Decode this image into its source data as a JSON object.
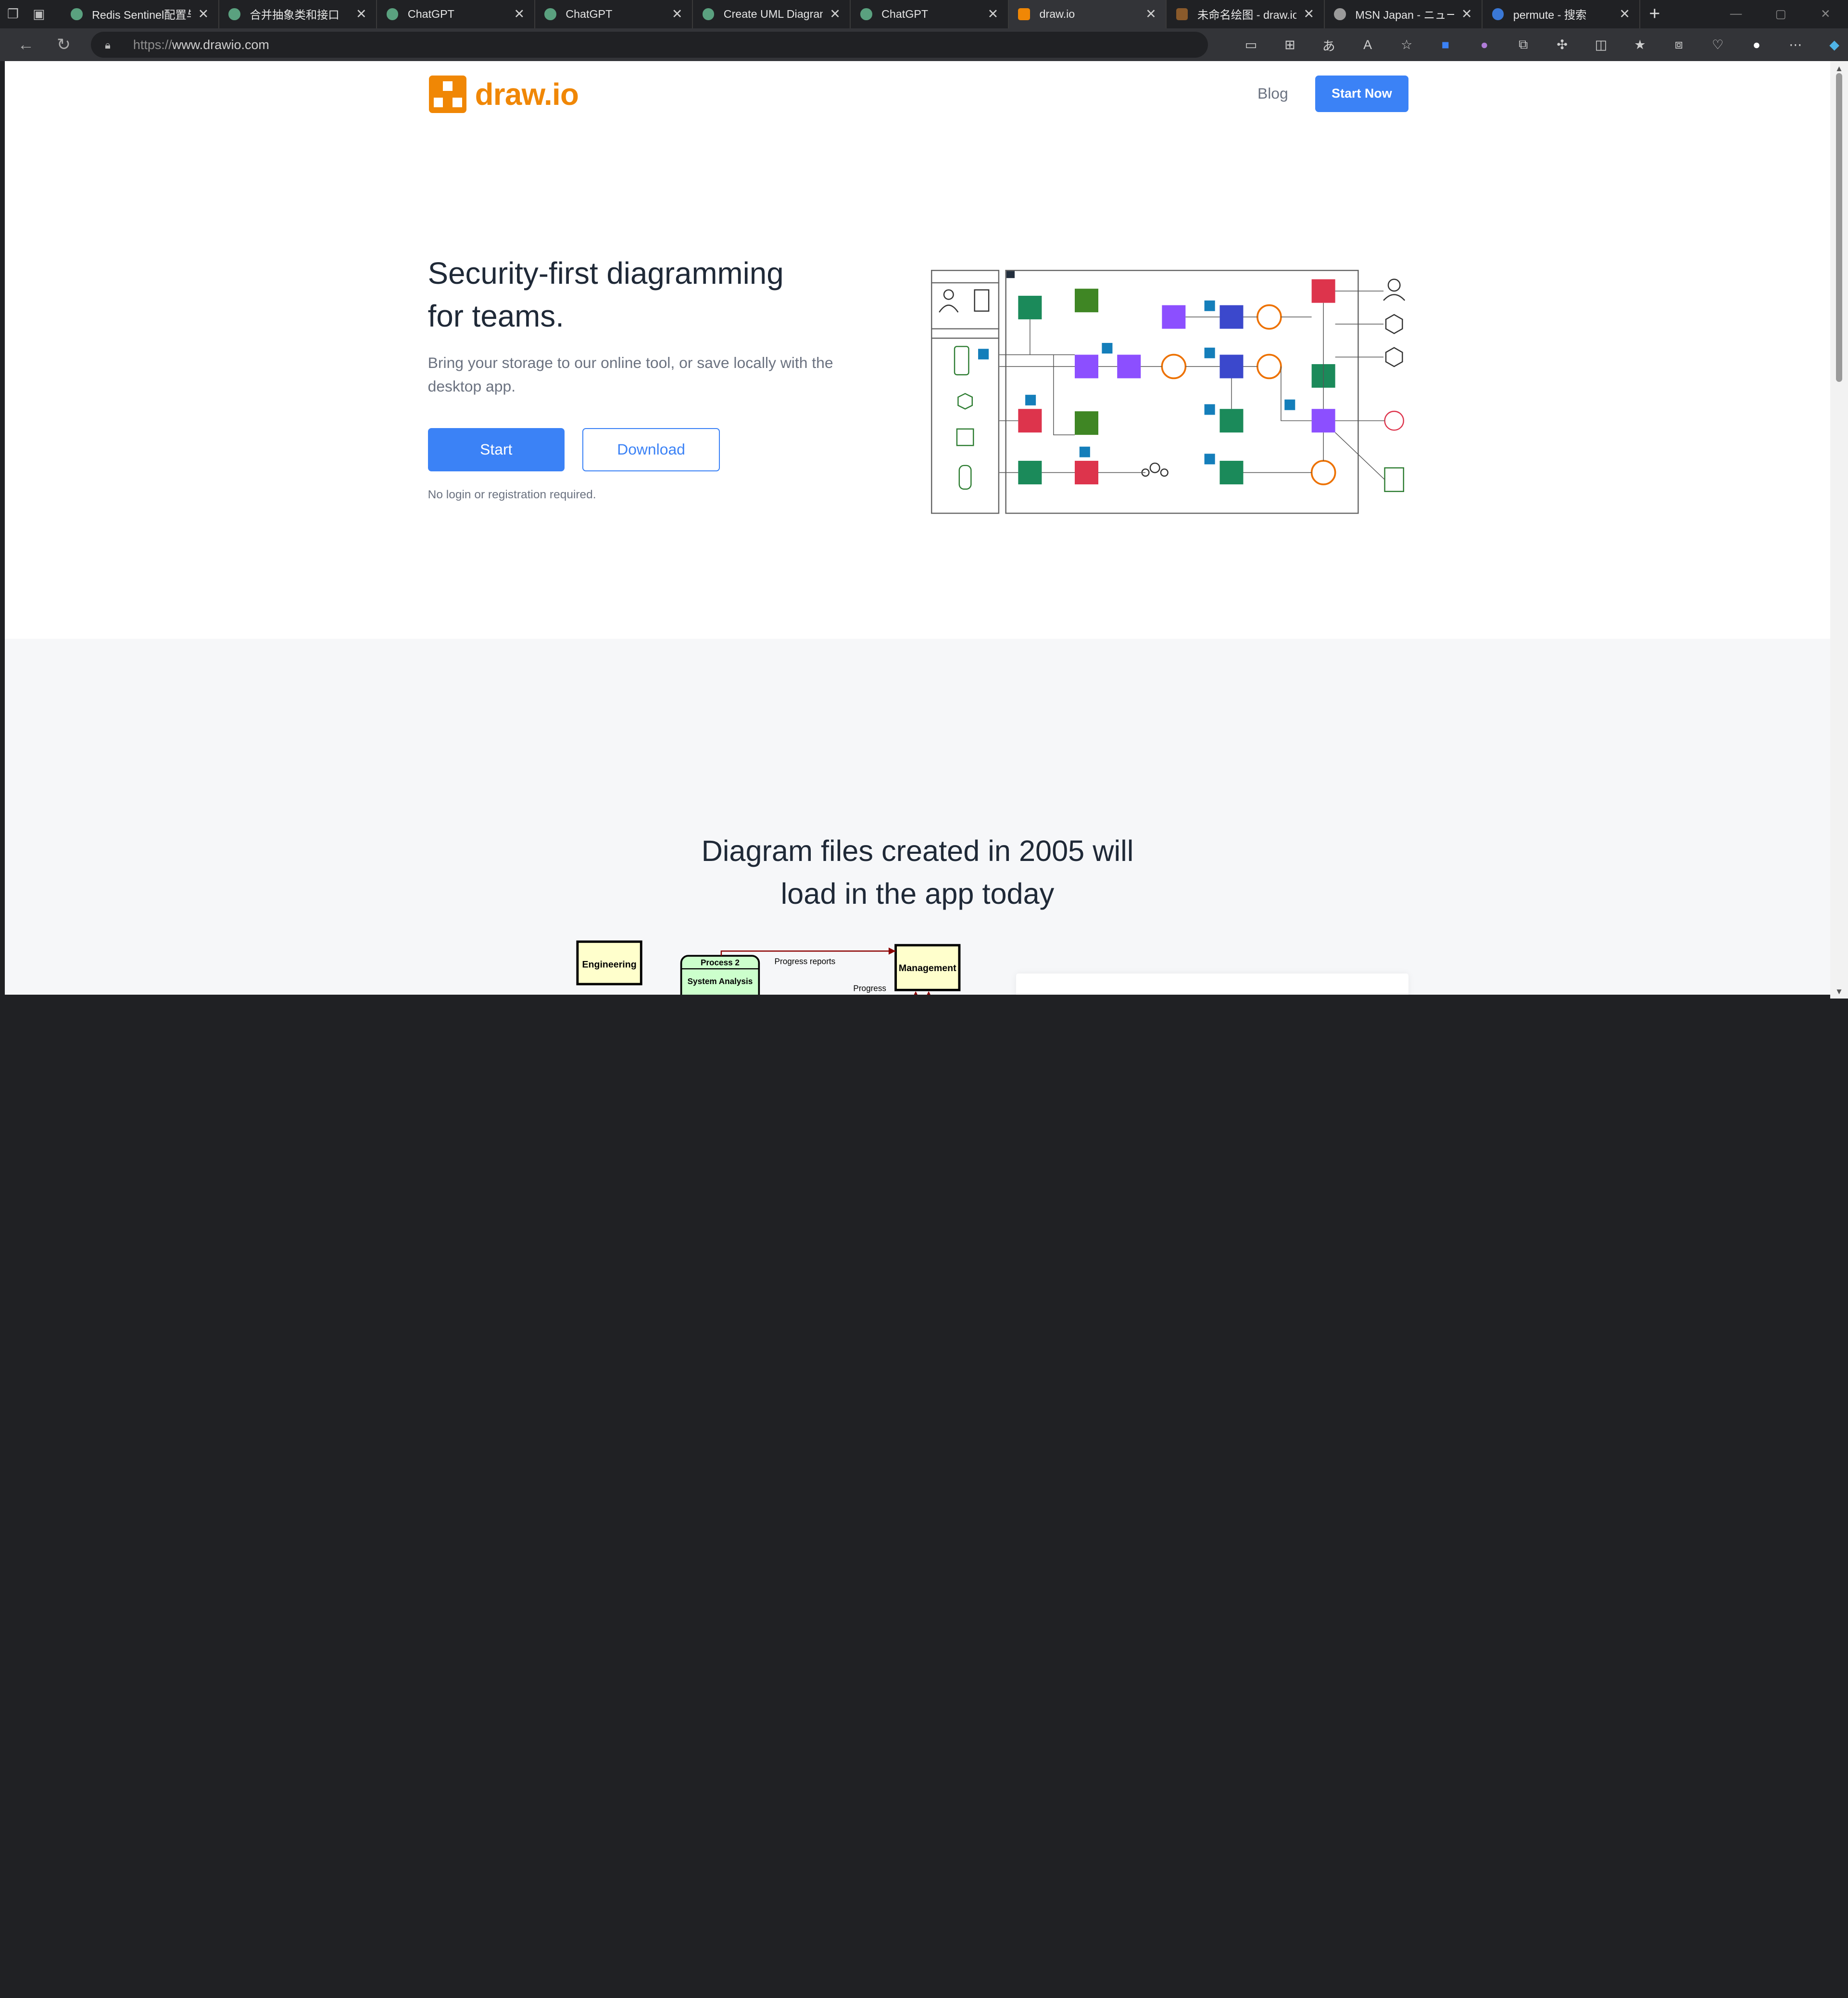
{
  "browser": {
    "tabs": [
      {
        "label": "Redis Sentinel配置与",
        "icon": "chatgpt-icon"
      },
      {
        "label": "合并抽象类和接口",
        "icon": "chatgpt-icon"
      },
      {
        "label": "ChatGPT",
        "icon": "chatgpt-icon"
      },
      {
        "label": "ChatGPT",
        "icon": "chatgpt-icon"
      },
      {
        "label": "Create UML Diagram",
        "icon": "chatgpt-icon"
      },
      {
        "label": "ChatGPT",
        "icon": "chatgpt-icon"
      },
      {
        "label": "draw.io",
        "icon": "drawio-icon",
        "active": true
      },
      {
        "label": "未命名绘图 - draw.io",
        "icon": "drawio-brown-icon"
      },
      {
        "label": "MSN Japan - ニュース",
        "icon": "msn-icon"
      },
      {
        "label": "permute - 搜索",
        "icon": "bing-icon"
      }
    ],
    "url_protocol": "https://",
    "url_host": "www.drawio.com"
  },
  "header": {
    "logo_text": "draw.io",
    "blog_label": "Blog",
    "start_now_label": "Start Now"
  },
  "hero": {
    "title_line1": "Security-first diagramming",
    "title_line2": "for teams.",
    "subtitle": "Bring your storage to our online tool, or save locally with the desktop app.",
    "start_label": "Start",
    "download_label": "Download",
    "note": "No login or registration required."
  },
  "section2": {
    "title_line1": "Diagram files created in 2005 will",
    "title_line2": "load in the app today"
  },
  "uml_preview": {
    "engineering": "Engineering",
    "process_title": "Process 2",
    "process_sub": "System Analysis",
    "management": "Management",
    "progress_reports": "Progress reports",
    "progress": "Progress"
  },
  "colors": {
    "brand_orange": "#f08705",
    "primary_blue": "#3b82f6"
  }
}
